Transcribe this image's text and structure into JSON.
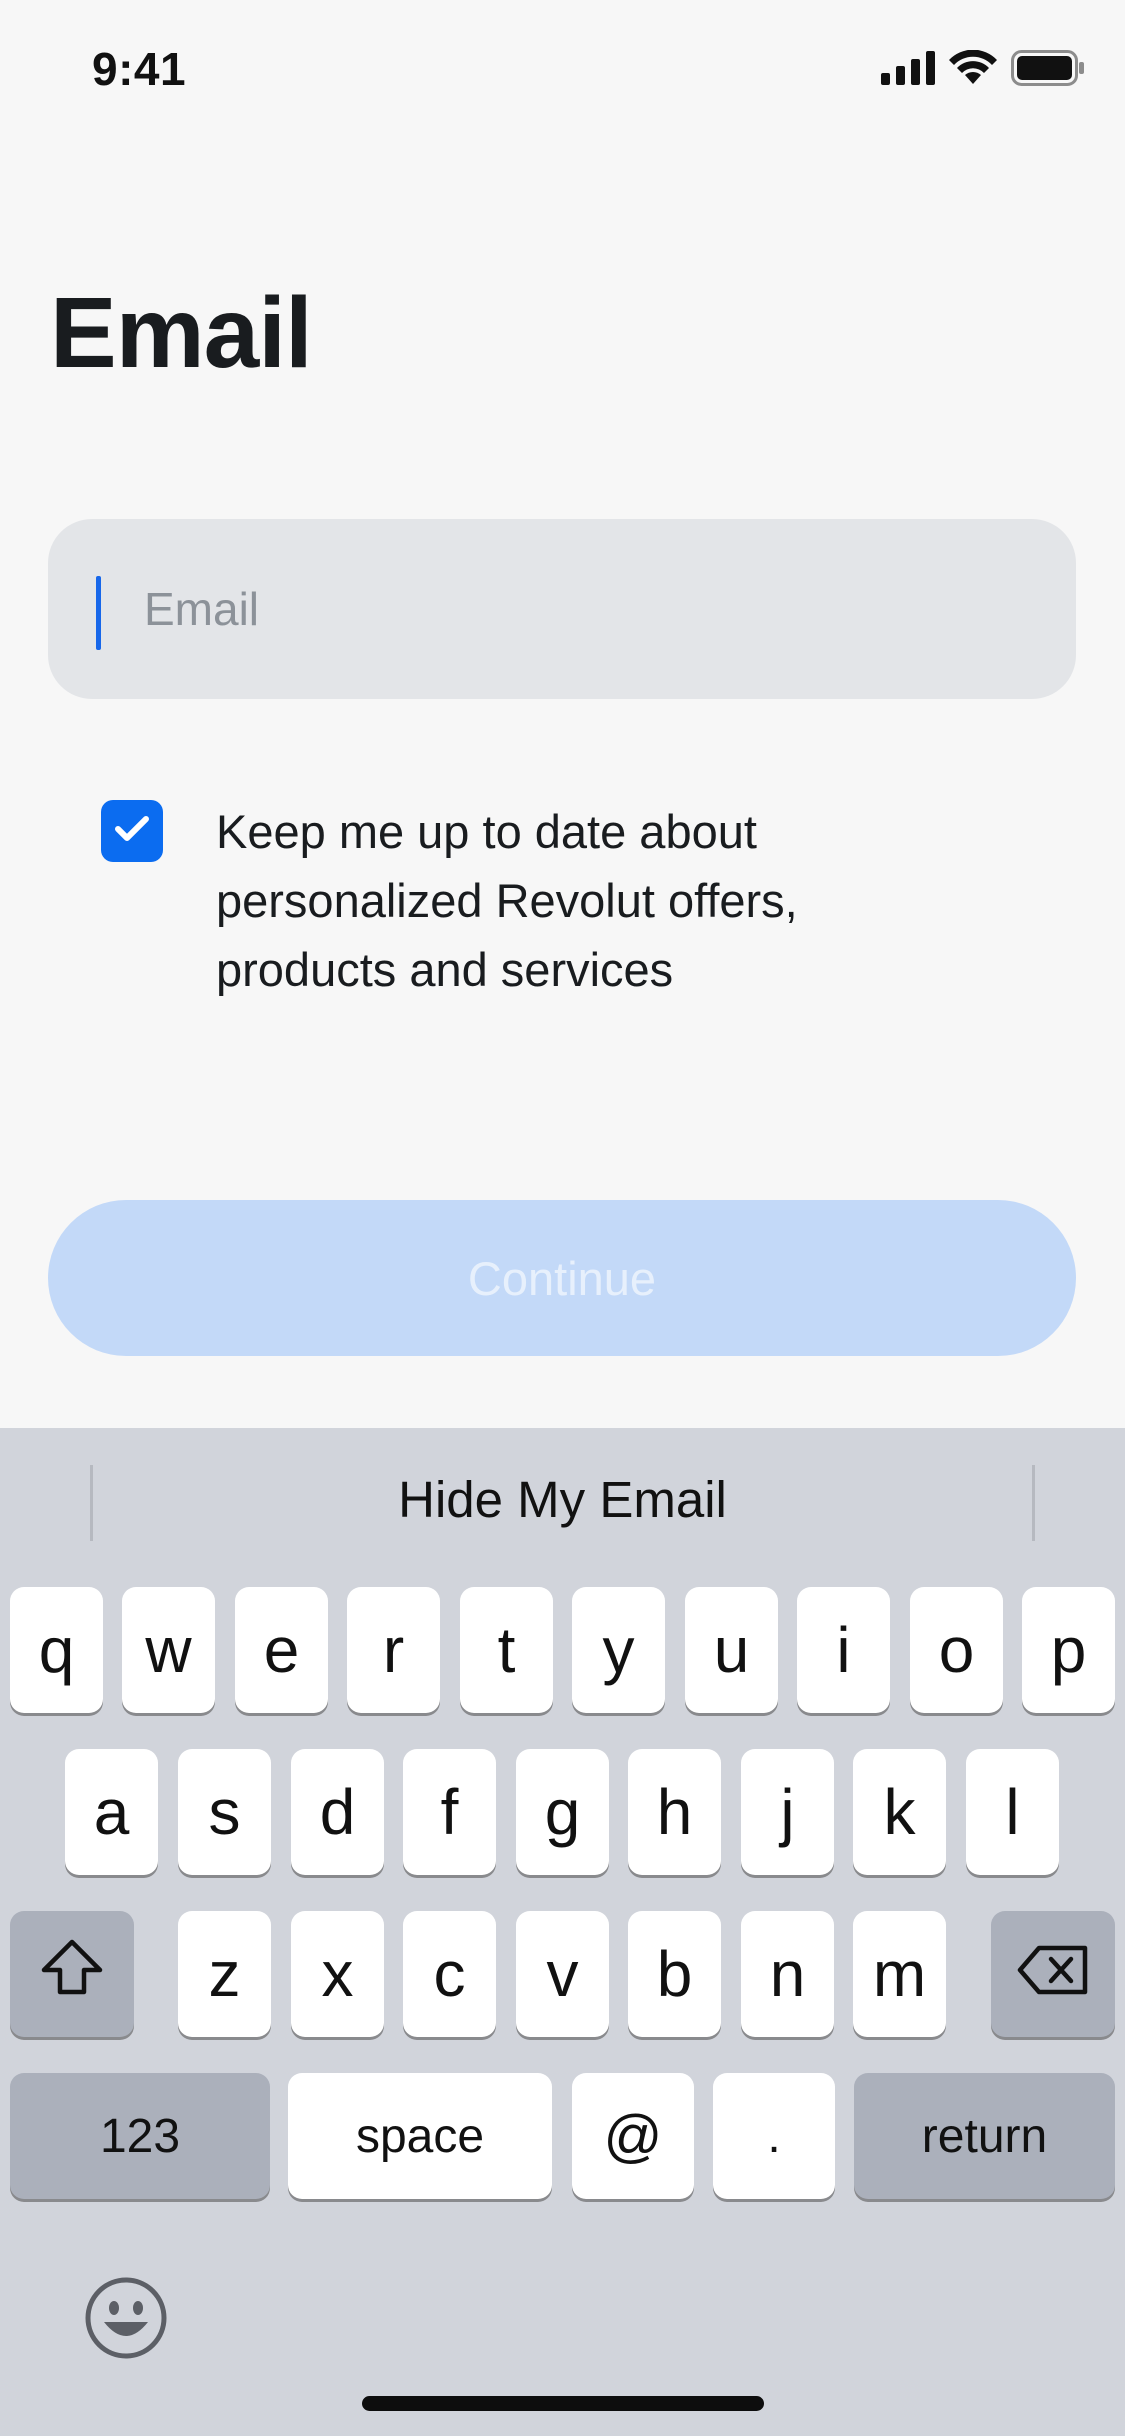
{
  "status_bar": {
    "time": "9:41"
  },
  "page": {
    "title": "Email"
  },
  "email_field": {
    "placeholder": "Email",
    "value": ""
  },
  "consent": {
    "checked": true,
    "text": "Keep me up to date about personalized Revolut offers, products and services"
  },
  "continue_button": {
    "label": "Continue",
    "enabled": false
  },
  "keyboard": {
    "suggestion": "Hide My Email",
    "row1": [
      "q",
      "w",
      "e",
      "r",
      "t",
      "y",
      "u",
      "i",
      "o",
      "p"
    ],
    "row2": [
      "a",
      "s",
      "d",
      "f",
      "g",
      "h",
      "j",
      "k",
      "l"
    ],
    "row3": [
      "z",
      "x",
      "c",
      "v",
      "b",
      "n",
      "m"
    ],
    "numbers_label": "123",
    "space_label": "space",
    "at_label": "@",
    "dot_label": ".",
    "return_label": "return"
  },
  "colors": {
    "accent": "#0b6cf0",
    "button_disabled": "#c3d9f8",
    "field_bg": "#e3e5e8",
    "keyboard_bg": "#d1d4db"
  }
}
